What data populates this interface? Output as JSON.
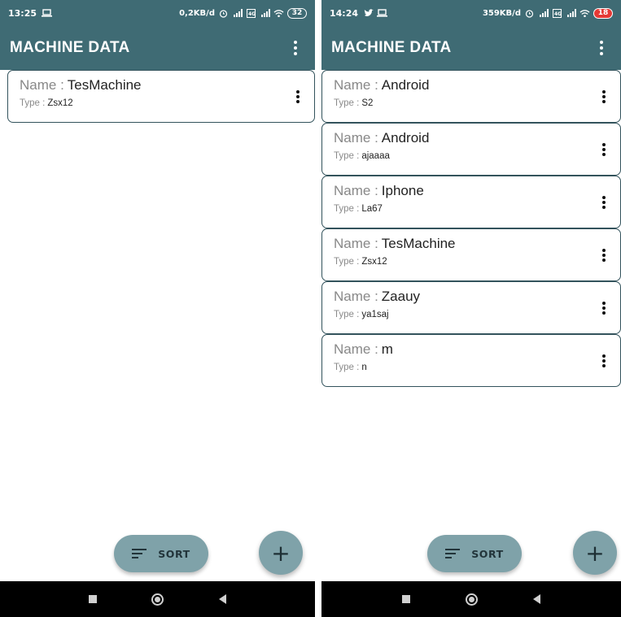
{
  "left": {
    "status": {
      "time": "13:25",
      "net": "0,2KB/d",
      "battery": "32"
    },
    "app_title": "MACHINE DATA",
    "name_label": "Name :",
    "type_label": "Type :",
    "machines": [
      {
        "name": "TesMachine",
        "type": "Zsx12"
      }
    ],
    "sort_label": "SORT",
    "fab_label": "+"
  },
  "right": {
    "status": {
      "time": "14:24",
      "net": "359KB/d",
      "battery": "18"
    },
    "app_title": "MACHINE DATA",
    "name_label": "Name :",
    "type_label": "Type :",
    "machines": [
      {
        "name": "Android",
        "type": "S2"
      },
      {
        "name": "Android",
        "type": "ajaaaa"
      },
      {
        "name": "Iphone",
        "type": "La67"
      },
      {
        "name": "TesMachine",
        "type": "Zsx12"
      },
      {
        "name": "Zaauy",
        "type": "ya1saj"
      },
      {
        "name": "m",
        "type": "n"
      }
    ],
    "sort_label": "SORT",
    "fab_label": "+"
  },
  "colors": {
    "appbar": "#3f6b74",
    "fab": "#7fa2a9",
    "card_border": "#33535c",
    "navbar": "#000000"
  },
  "icons": {
    "status_left": [
      "laptop-icon",
      "twitter-icon"
    ],
    "status_right": [
      "alarm-icon",
      "signal-icon",
      "data-icon",
      "wifi-icon",
      "battery-icon"
    ],
    "appbar": [
      "more-vert-icon"
    ],
    "card": [
      "more-vert-icon"
    ],
    "sort": [
      "sort-icon"
    ],
    "nav": [
      "recents-icon",
      "home-icon",
      "back-icon"
    ]
  }
}
